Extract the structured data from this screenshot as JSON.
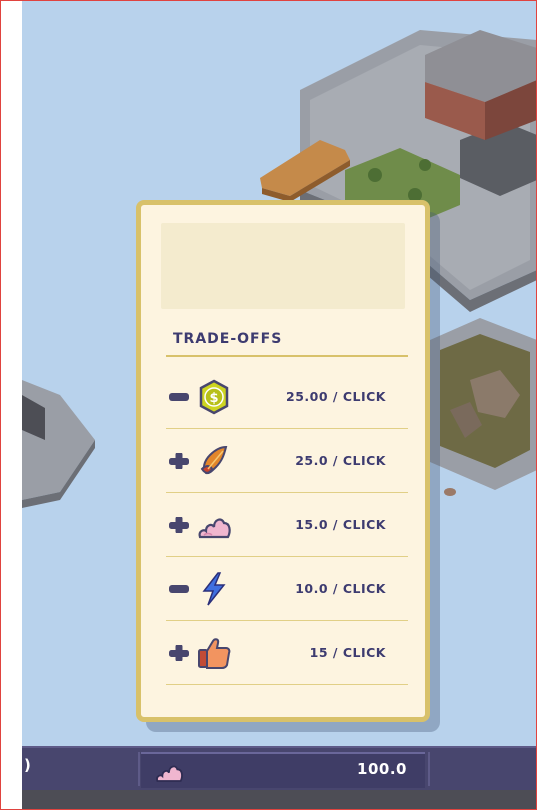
{
  "panel": {
    "section_title": "TRADE-OFFS",
    "rows": [
      {
        "sign": "minus",
        "icon": "coin-icon",
        "rate": "25.00 / CLICK"
      },
      {
        "sign": "plus",
        "icon": "food-icon",
        "rate": "25.0 / CLICK"
      },
      {
        "sign": "plus",
        "icon": "pollution-icon",
        "rate": "15.0 / CLICK"
      },
      {
        "sign": "minus",
        "icon": "energy-icon",
        "rate": "10.0 / CLICK"
      },
      {
        "sign": "plus",
        "icon": "thumbs-up-icon",
        "rate": "15 / CLICK"
      }
    ]
  },
  "resource_bar": {
    "left_fragment": ")",
    "pollution_value": "100.0"
  },
  "colors": {
    "panel_bg": "#fdf4e0",
    "panel_border": "#d8c16a",
    "text": "#3d3b70",
    "bar_bg": "#48466e"
  }
}
